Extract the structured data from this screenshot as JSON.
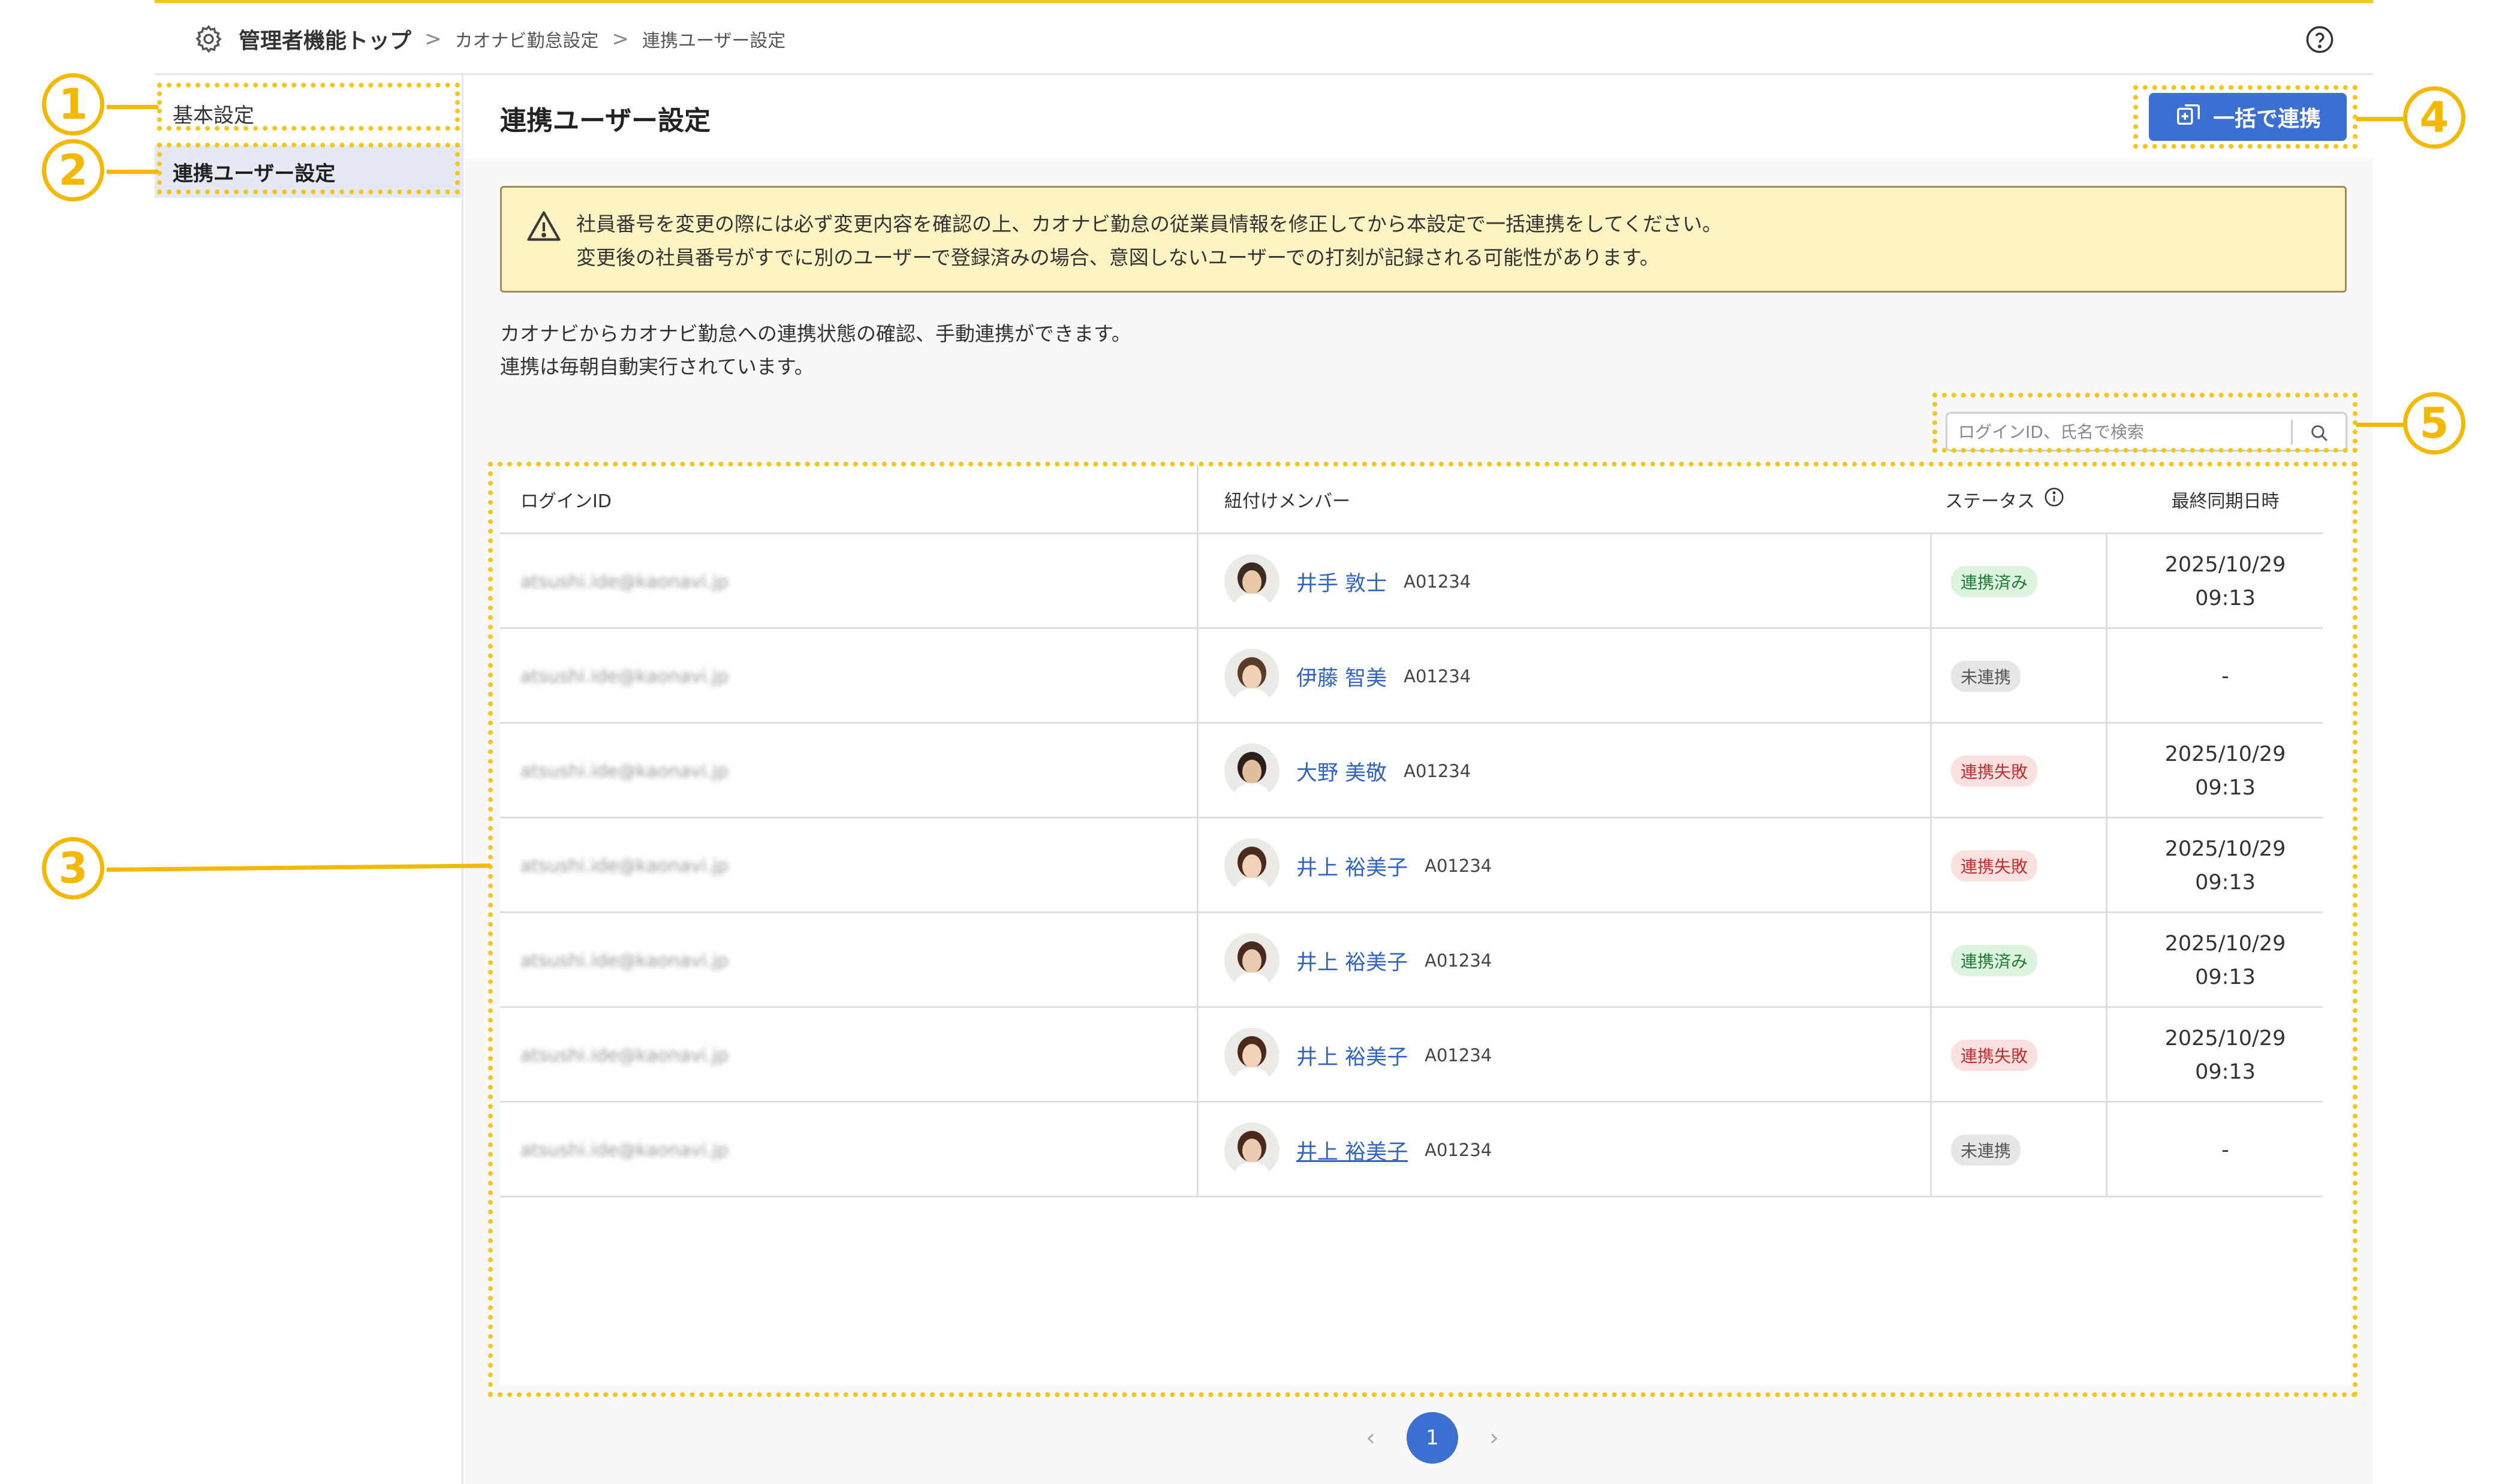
{
  "breadcrumb": {
    "root": "管理者機能トップ",
    "sep": ">",
    "items": [
      "カオナビ勤怠設定",
      "連携ユーザー設定"
    ]
  },
  "header": {
    "help_icon": "help-circle-icon"
  },
  "sidebar": {
    "items": [
      {
        "label": "基本設定",
        "active": false
      },
      {
        "label": "連携ユーザー設定",
        "active": true
      }
    ]
  },
  "main": {
    "title": "連携ユーザー設定",
    "bulk_button_label": "一括で連携",
    "warning_lines": [
      "社員番号を変更の際には必ず変更内容を確認の上、カオナビ勤怠の従業員情報を修正してから本設定で一括連携をしてください。",
      "変更後の社員番号がすでに別のユーザーで登録済みの場合、意図しないユーザーでの打刻が記録される可能性があります。"
    ],
    "description_lines": [
      "カオナビからカオナビ勤怠への連携状態の確認、手動連携ができます。",
      "連携は毎朝自動実行されています。"
    ],
    "search": {
      "placeholder": "ログインID、氏名で検索",
      "value": ""
    }
  },
  "table": {
    "columns": [
      "ログインID",
      "紐付けメンバー",
      "ステータス",
      "最終同期日時"
    ],
    "rows": [
      {
        "login": "atsushi.ide@kaonavi.jp",
        "name": "井手 敦士",
        "code": "A01234",
        "status": "連携済み",
        "status_type": "ok",
        "date": "2025/10/29",
        "time": "09:13"
      },
      {
        "login": "atsushi.ide@kaonavi.jp",
        "name": "伊藤 智美",
        "code": "A01234",
        "status": "未連携",
        "status_type": "none",
        "date": "-",
        "time": ""
      },
      {
        "login": "atsushi.ide@kaonavi.jp",
        "name": "大野 美敬",
        "code": "A01234",
        "status": "連携失敗",
        "status_type": "fail",
        "date": "2025/10/29",
        "time": "09:13"
      },
      {
        "login": "atsushi.ide@kaonavi.jp",
        "name": "井上 裕美子",
        "code": "A01234",
        "status": "連携失敗",
        "status_type": "fail",
        "date": "2025/10/29",
        "time": "09:13"
      },
      {
        "login": "atsushi.ide@kaonavi.jp",
        "name": "井上 裕美子",
        "code": "A01234",
        "status": "連携済み",
        "status_type": "ok",
        "date": "2025/10/29",
        "time": "09:13"
      },
      {
        "login": "atsushi.ide@kaonavi.jp",
        "name": "井上 裕美子",
        "code": "A01234",
        "status": "連携失敗",
        "status_type": "fail",
        "date": "2025/10/29",
        "time": "09:13"
      },
      {
        "login": "atsushi.ide@kaonavi.jp",
        "name": "井上 裕美子",
        "code": "A01234",
        "status": "未連携",
        "status_type": "none",
        "date": "-",
        "time": ""
      }
    ]
  },
  "pagination": {
    "prev": "‹",
    "current": "1",
    "next": "›"
  },
  "annotations": {
    "labels": [
      "1",
      "2",
      "3",
      "4",
      "5"
    ],
    "color": "#f5b800"
  },
  "colors": {
    "accent": "#3b6fd1",
    "warning_bg": "#fbf4c2",
    "status_ok": "#217a36",
    "status_fail": "#c02f2f"
  }
}
